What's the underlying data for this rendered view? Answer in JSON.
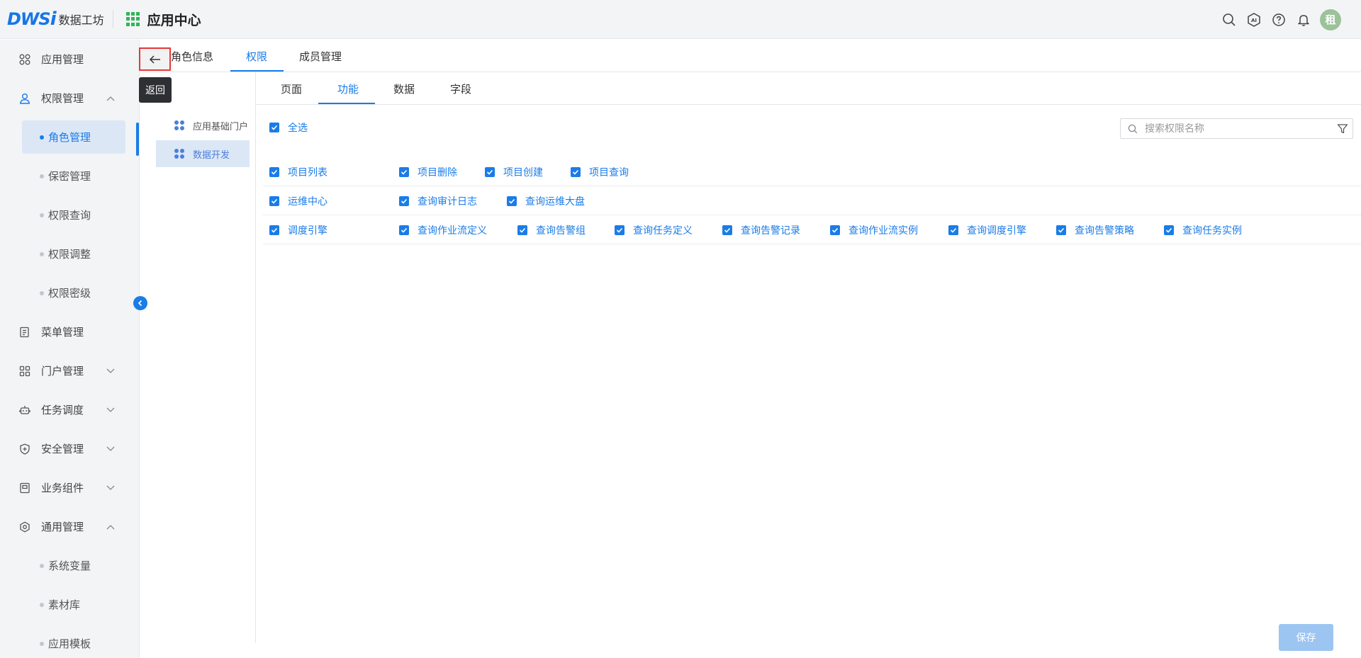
{
  "header": {
    "logo_brand": "DWS",
    "logo_i": "i",
    "logo_text": "数据工坊",
    "app_center_title": "应用中心",
    "ai_label": "AI",
    "avatar_text": "租"
  },
  "sidebar": {
    "items": [
      {
        "label": "应用管理",
        "icon": "apps-icon"
      },
      {
        "label": "权限管理",
        "icon": "user-icon",
        "expanded": true
      },
      {
        "label": "角色管理",
        "sub": true,
        "active": true
      },
      {
        "label": "保密管理",
        "sub": true
      },
      {
        "label": "权限查询",
        "sub": true
      },
      {
        "label": "权限调整",
        "sub": true
      },
      {
        "label": "权限密级",
        "sub": true
      },
      {
        "label": "菜单管理",
        "icon": "menu-doc-icon"
      },
      {
        "label": "门户管理",
        "icon": "portal-icon",
        "expanded": false
      },
      {
        "label": "任务调度",
        "icon": "robot-icon",
        "expanded": false
      },
      {
        "label": "安全管理",
        "icon": "shield-icon",
        "expanded": false
      },
      {
        "label": "业务组件",
        "icon": "component-icon",
        "expanded": false
      },
      {
        "label": "通用管理",
        "icon": "settings-icon",
        "expanded": true
      },
      {
        "label": "系统变量",
        "sub": true
      },
      {
        "label": "素材库",
        "sub": true
      },
      {
        "label": "应用模板",
        "sub": true
      }
    ]
  },
  "back": {
    "tooltip": "返回"
  },
  "top_tabs": [
    {
      "label": "角色信息"
    },
    {
      "label": "权限",
      "active": true
    },
    {
      "label": "成员管理"
    }
  ],
  "app_list": [
    {
      "label": "应用基础门户"
    },
    {
      "label": "数据开发",
      "selected": true
    }
  ],
  "sub_tabs": [
    {
      "label": "页面"
    },
    {
      "label": "功能",
      "active": true
    },
    {
      "label": "数据"
    },
    {
      "label": "字段"
    }
  ],
  "select_all_label": "全选",
  "search": {
    "placeholder": "搜索权限名称",
    "value": ""
  },
  "permissions": [
    {
      "group": "项目列表",
      "items": [
        "项目删除",
        "项目创建",
        "项目查询"
      ]
    },
    {
      "group": "运维中心",
      "items": [
        "查询审计日志",
        "查询运维大盘"
      ]
    },
    {
      "group": "调度引擎",
      "items": [
        "查询作业流定义",
        "查询告警组",
        "查询任务定义",
        "查询告警记录",
        "查询作业流实例",
        "查询调度引擎",
        "查询告警策略",
        "查询任务实例"
      ]
    }
  ],
  "save_label": "保存",
  "colors": {
    "accent": "#1a7ce8",
    "save_disabled": "#9dc5f2",
    "tooltip_bg": "#2e2f33"
  }
}
